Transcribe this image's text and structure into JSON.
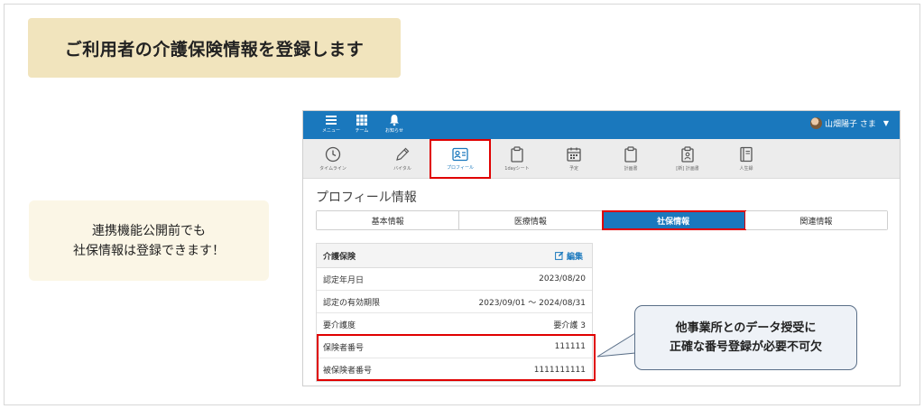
{
  "title": "ご利用者の介護保険情報を登録します",
  "note": {
    "line1": "連携機能公開前でも",
    "line2": "社保情報は登録できます！"
  },
  "topbar": {
    "menu_label": "メニュー",
    "team_label": "チーム",
    "notify_label": "お知らせ",
    "user_name": "山畑陽子 さま",
    "user_caret": "▼"
  },
  "nav": {
    "items": [
      {
        "label": "タイムライン",
        "icon": "clock-icon"
      },
      {
        "label": "バイタル",
        "icon": "pencil-icon"
      },
      {
        "label": "プロフィール",
        "icon": "profile-card-icon"
      },
      {
        "label": "1dayシート",
        "icon": "clipboard-icon"
      },
      {
        "label": "予定",
        "icon": "calendar-icon"
      },
      {
        "label": "計画書",
        "icon": "clipboard-icon"
      },
      {
        "label": "[新] 計画書",
        "icon": "id-badge-icon"
      },
      {
        "label": "人生録",
        "icon": "book-icon"
      }
    ],
    "active_index": 2
  },
  "page_heading": "プロフィール情報",
  "tabs": [
    "基本情報",
    "医療情報",
    "社保情報",
    "関連情報"
  ],
  "active_tab": 2,
  "card": {
    "title": "介護保険",
    "edit_label": "編集",
    "rows": [
      {
        "label": "認定年月日",
        "value": "2023/08/20"
      },
      {
        "label": "認定の有効期限",
        "value": "2023/09/01 〜 2024/08/31"
      },
      {
        "label": "要介護度",
        "value": "要介護 3"
      },
      {
        "label": "保険者番号",
        "value": "111111"
      },
      {
        "label": "被保険者番号",
        "value": "1111111111"
      }
    ]
  },
  "callout": {
    "line1": "他事業所とのデータ授受に",
    "line2": "正確な番号登録が必要不可欠"
  },
  "colors": {
    "brand_blue": "#1a78bd",
    "highlight_red": "#e00000",
    "title_bg": "#f1e4bd",
    "note_bg": "#fbf6e6"
  }
}
